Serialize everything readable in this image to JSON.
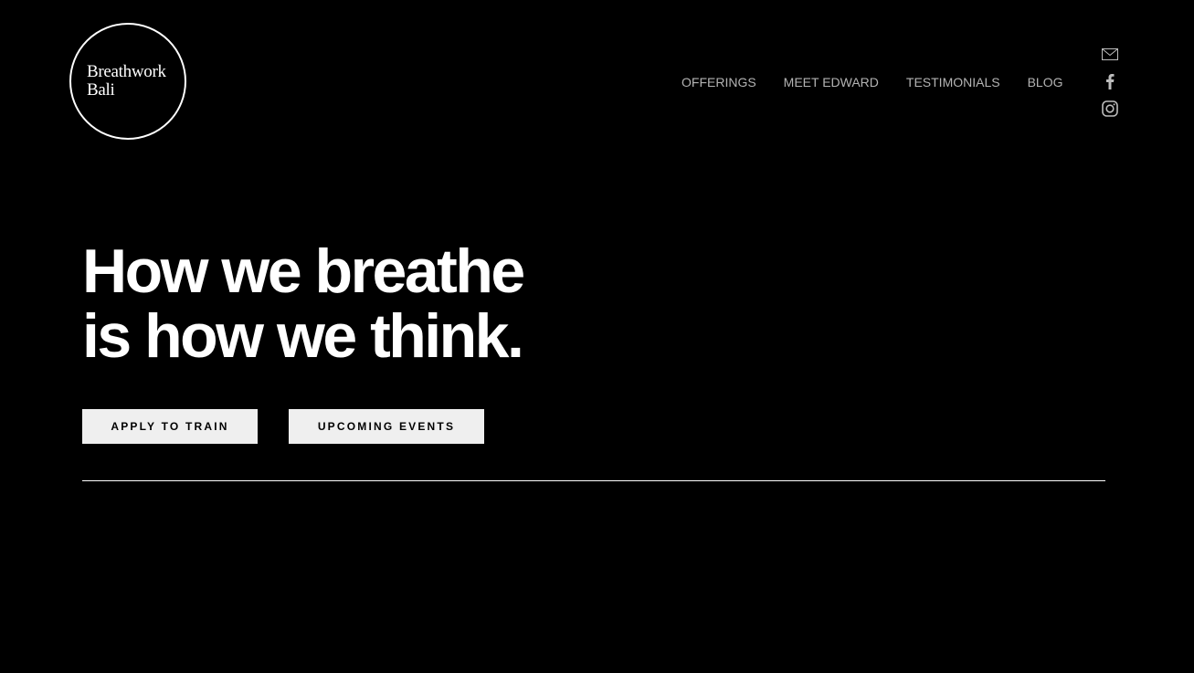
{
  "logo": {
    "line1": "Breathwork",
    "line2": "Bali"
  },
  "nav": {
    "items": [
      {
        "label": "OFFERINGS"
      },
      {
        "label": "MEET EDWARD"
      },
      {
        "label": "TESTIMONIALS"
      },
      {
        "label": "BLOG"
      }
    ]
  },
  "social": {
    "icons": [
      "mail-icon",
      "facebook-icon",
      "instagram-icon"
    ],
    "icon_color": "#bdbdbd"
  },
  "hero": {
    "line1": "How we breathe",
    "line2": "is how we think."
  },
  "buttons": {
    "apply_label": "APPLY TO TRAIN",
    "events_label": "UPCOMING EVENTS"
  },
  "colors": {
    "background": "#000000",
    "text": "#ffffff",
    "nav_text": "#b3b3b3",
    "button_bg": "#efefef"
  }
}
